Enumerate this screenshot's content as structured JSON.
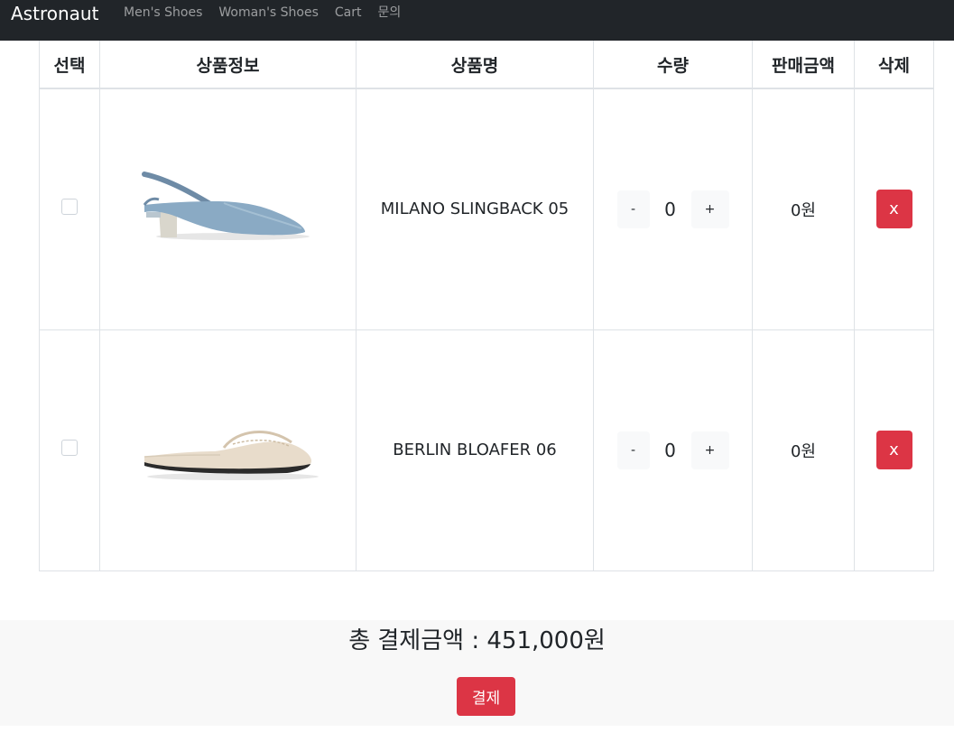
{
  "navbar": {
    "brand": "Astronaut",
    "links": [
      "Men's Shoes",
      "Woman's Shoes",
      "Cart",
      "문의"
    ]
  },
  "table": {
    "headers": [
      "선택",
      "상품정보",
      "상품명",
      "수량",
      "판매금액",
      "삭제"
    ],
    "rows": [
      {
        "name": "MILANO SLINGBACK 05",
        "quantity": "0",
        "price": "0원",
        "minus": "-",
        "plus": "+",
        "delete": "x",
        "image": "blue-slingback-shoe"
      },
      {
        "name": "BERLIN BLOAFER 06",
        "quantity": "0",
        "price": "0원",
        "minus": "-",
        "plus": "+",
        "delete": "x",
        "image": "beige-loafer-mule"
      }
    ]
  },
  "summary": {
    "total_text": "총 결제금액 : 451,000원",
    "pay_label": "결제"
  },
  "colors": {
    "navbar_bg": "#212529",
    "danger": "#dc3545",
    "summary_bg": "#f8f8f8"
  }
}
